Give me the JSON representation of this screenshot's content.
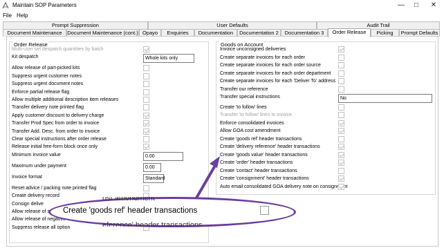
{
  "window": {
    "title": "Maintain SOP Parameters"
  },
  "menu": [
    "File",
    "Help"
  ],
  "tabs_top": [
    "Prompt Suppression",
    "User Defaults",
    "Audit Trail"
  ],
  "tabs_bottom": [
    "Document Maintenance",
    "Document Maintenance (cont.)",
    "Opayo",
    "Enquiries",
    "Documentation",
    "Documentation 2",
    "Documentation 3",
    "Order Release",
    "Picking",
    "Prompt Defaults"
  ],
  "active_tab": "Order Release",
  "order_release": {
    "title": "Order Release",
    "items": [
      {
        "label": "Multi-user set despatch quantities by batch",
        "type": "check",
        "checked": true,
        "enabled": false
      },
      {
        "label": "Kit despatch",
        "type": "text",
        "value": "Whole kits only"
      },
      {
        "label": "Allow release of part-picked kits",
        "type": "check",
        "checked": false
      },
      {
        "label": "Suppress urgent customer notes",
        "type": "check",
        "checked": false
      },
      {
        "label": "Suppress urgent document notes",
        "type": "check",
        "checked": false
      },
      {
        "label": "Enforce partial release flag",
        "type": "check",
        "checked": false
      },
      {
        "label": "Allow multiple additional description item releases",
        "type": "check",
        "checked": false
      },
      {
        "label": "Transfer delivery note printed flag",
        "type": "check",
        "checked": false
      },
      {
        "label": "Apply customer discount to delivery charge",
        "type": "check",
        "checked": true
      },
      {
        "label": "Transfer Prod Spec from order to invoice",
        "type": "check",
        "checked": true
      },
      {
        "label": "Transfer Add. Desc. from order to invoice",
        "type": "check",
        "checked": true
      },
      {
        "label": "Clear special instructions after order release",
        "type": "check",
        "checked": false
      },
      {
        "label": "Release initial free-form block once only",
        "type": "check",
        "checked": true
      },
      {
        "label": "Minimum invoice value",
        "type": "text",
        "value": "0.00"
      },
      {
        "label": "Maximum under payment",
        "type": "text",
        "value": "0.00"
      },
      {
        "label": "Invoice format",
        "type": "text",
        "value": "Standard"
      },
      {
        "label": "Reset advice / packing note printed flag",
        "type": "check",
        "checked": false
      },
      {
        "label": "Create delivery record",
        "type": "check",
        "checked": false
      },
      {
        "label": "Consign delive",
        "type": "check",
        "checked": false
      },
      {
        "label": "Allow release of s",
        "type": "check",
        "checked": false
      },
      {
        "label": "Allow release of negative orders/returns when customer is on stop",
        "type": "check",
        "checked": false
      },
      {
        "label": "Suppress release all option",
        "type": "check",
        "checked": false
      }
    ]
  },
  "goods_on_account": {
    "title": "Goods on Account",
    "items": [
      {
        "label": "Invoice unconsigned deliveries",
        "type": "check",
        "checked": true
      },
      {
        "label": "Create separate invoices for each order",
        "type": "check",
        "checked": false
      },
      {
        "label": "Create separate invoices for each order source",
        "type": "check",
        "checked": false
      },
      {
        "label": "Create separate invoices for each order department",
        "type": "check",
        "checked": false
      },
      {
        "label": "Create separate invoices for each 'Deliver To' address",
        "type": "check",
        "checked": false
      },
      {
        "label": "Transfer our reference",
        "type": "check",
        "checked": false
      },
      {
        "label": "Transfer special instructions",
        "type": "text",
        "value": "No"
      },
      {
        "label": "Create 'to follow' lines",
        "type": "check",
        "checked": false
      },
      {
        "label": "Transfer 'to follow' lines to invoice",
        "type": "check",
        "checked": false,
        "enabled": false
      },
      {
        "label": "Enforce consolidated invoices",
        "type": "check",
        "checked": true
      },
      {
        "label": "Allow GOA cost amendment",
        "type": "check",
        "checked": true
      },
      {
        "label": "Create 'goods ref' header transactions",
        "type": "check",
        "checked": false
      },
      {
        "label": "Create 'delivery reference' header transactions",
        "type": "check",
        "checked": true
      },
      {
        "label": "Create 'goods value' header transactions",
        "type": "check",
        "checked": true
      },
      {
        "label": "Create 'order' header transactions",
        "type": "check",
        "checked": true
      },
      {
        "label": "Create 'contact' header transactions",
        "type": "check",
        "checked": false
      },
      {
        "label": "Create 'consignment' header transactions",
        "type": "check",
        "checked": true
      },
      {
        "label": "Auto email consolidated GOA delivery note on consignment",
        "type": "check",
        "checked": true
      }
    ]
  },
  "callout": {
    "label": "Create 'goods ref' header transactions",
    "ghost_above": "ost amendment",
    "ghost_below": "eference' header transactions",
    "color": "#6b3e9e"
  }
}
